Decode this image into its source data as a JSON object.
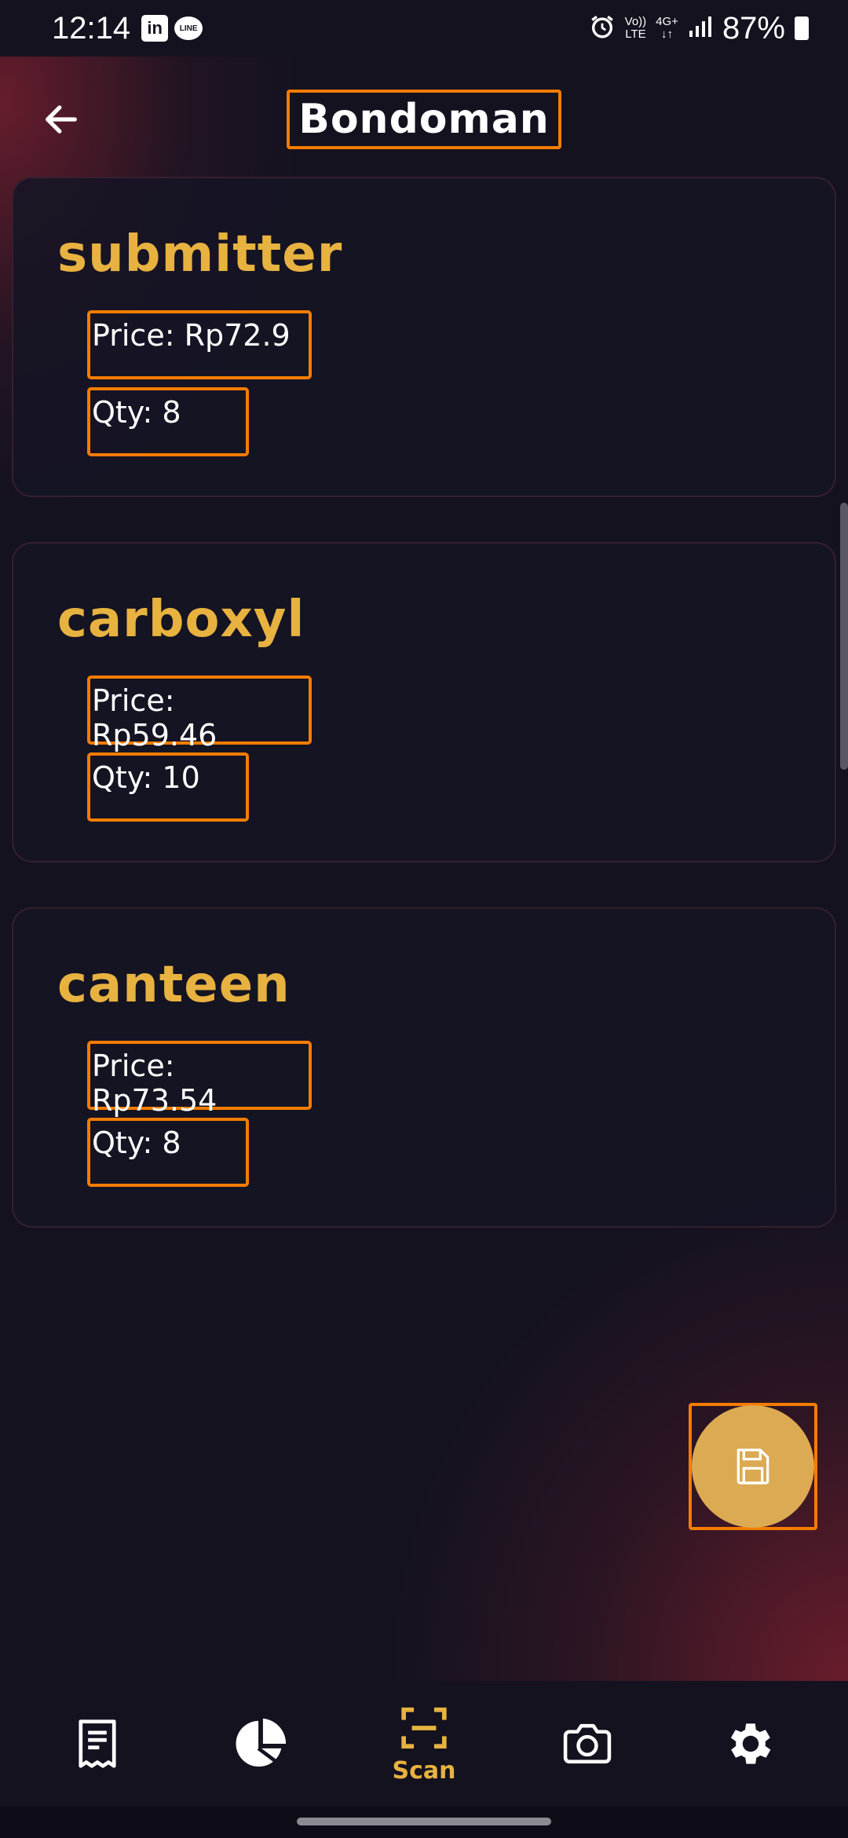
{
  "status_bar": {
    "time": "12:14",
    "app_icon_1": "LinkedIn",
    "app_icon_1_text": "in",
    "app_icon_2": "LINE",
    "network_top": "Vo))",
    "network_bottom": "LTE",
    "data_type": "4G+",
    "battery": "87%",
    "icons": [
      "alarm-icon",
      "signal-icon",
      "battery-icon"
    ]
  },
  "header": {
    "title": "Bondoman",
    "back_icon": "arrow-left-icon"
  },
  "items": [
    {
      "name": "submitter",
      "price": "Price: Rp72.9",
      "qty": "Qty: 8"
    },
    {
      "name": "carboxyl",
      "price": "Price: Rp59.46",
      "qty": "Qty: 10"
    },
    {
      "name": "canteen",
      "price": "Price: Rp73.54",
      "qty": "Qty: 8"
    }
  ],
  "fab": {
    "icon": "save-icon"
  },
  "bottom_nav": {
    "items": [
      {
        "icon": "receipt-icon",
        "label": ""
      },
      {
        "icon": "pie-chart-icon",
        "label": ""
      },
      {
        "icon": "scan-icon",
        "label": "Scan",
        "active": true
      },
      {
        "icon": "camera-icon",
        "label": ""
      },
      {
        "icon": "gear-icon",
        "label": ""
      }
    ]
  },
  "colors": {
    "background": "#14121f",
    "accent": "#e7b23f",
    "highlight_border": "#f57c00",
    "fab": "#dcaa52"
  }
}
